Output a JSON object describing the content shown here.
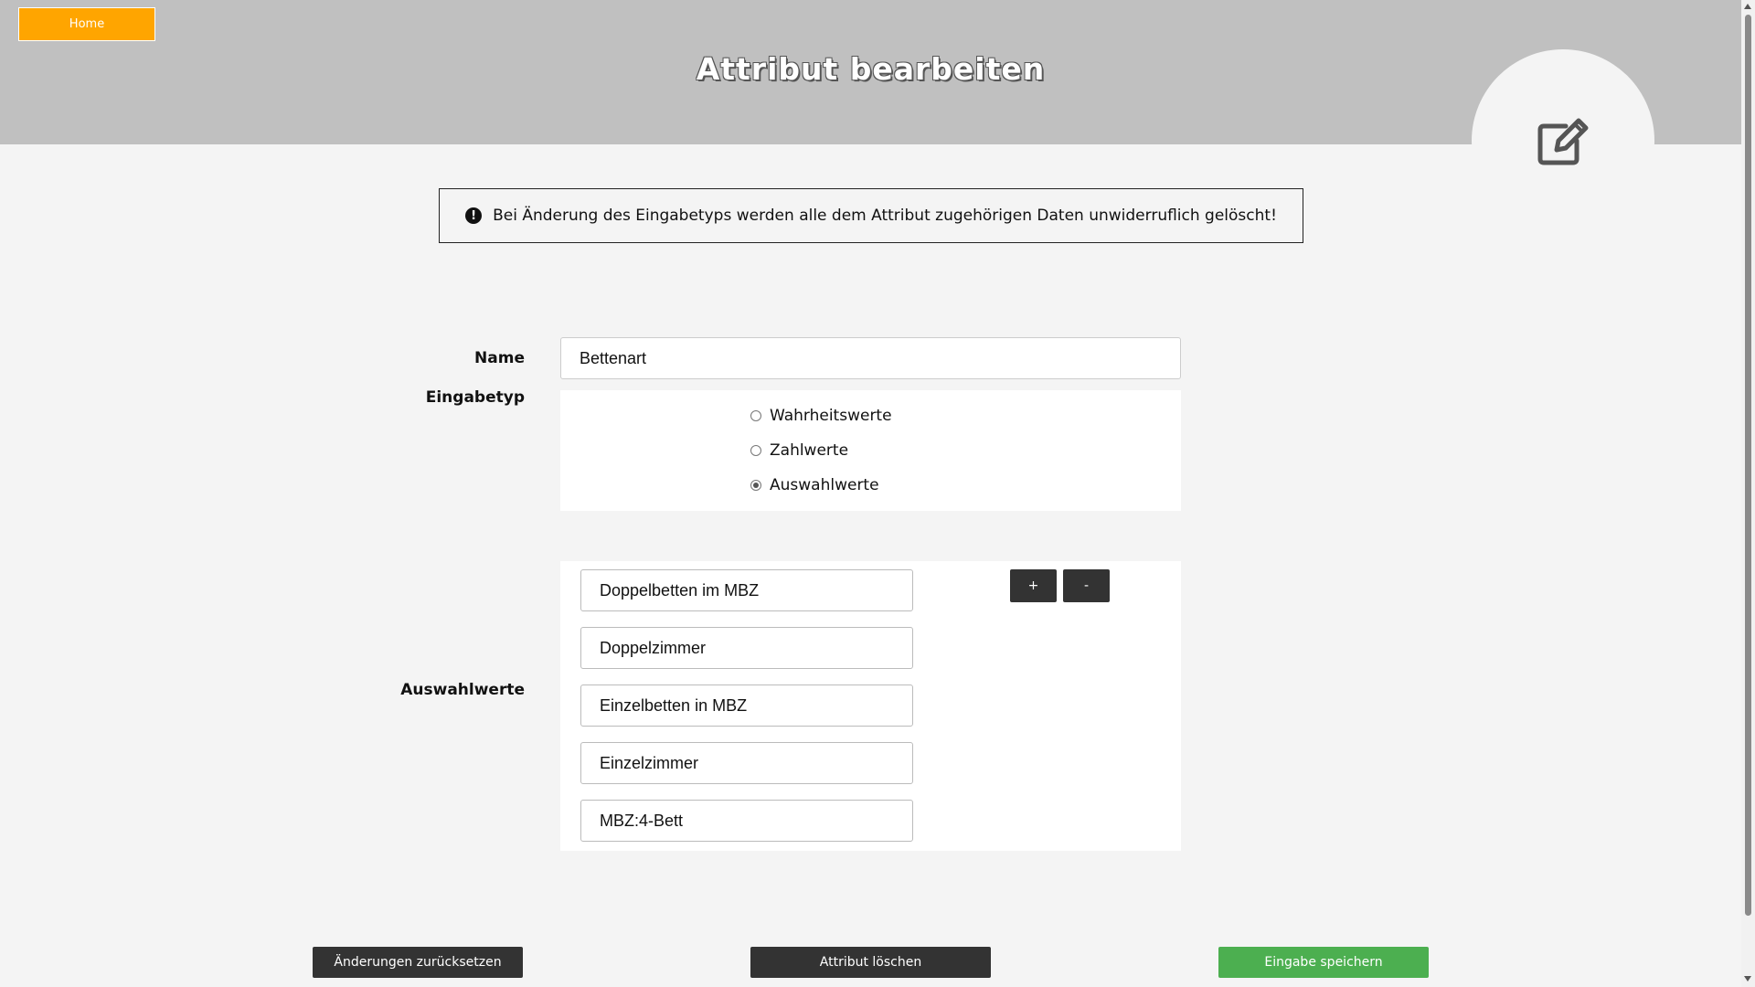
{
  "header": {
    "home_label": "Home",
    "title": "Attribut bearbeiten",
    "bg_color": "#c0c0c0",
    "home_color": "#ffa500",
    "icon": "edit-icon"
  },
  "warning": {
    "icon": "exclamation-circle-icon",
    "text": "Bei Änderung des Eingabetyps werden alle dem Attribut zugehörigen Daten unwiderruflich gelöscht!"
  },
  "form": {
    "name_label": "Name",
    "name_value": "Bettenart",
    "type_label": "Eingabetyp",
    "types": [
      {
        "label": "Wahrheitswerte",
        "checked": false
      },
      {
        "label": "Zahlwerte",
        "checked": false
      },
      {
        "label": "Auswahlwerte",
        "checked": true
      }
    ],
    "options_label": "Auswahlwerte",
    "options": [
      "Doppelbetten im MBZ",
      "Doppelzimmer",
      "Einzelbetten in MBZ",
      "Einzelzimmer",
      "MBZ:4-Bett"
    ],
    "add_label": "+",
    "remove_label": "-"
  },
  "footer": {
    "reset_label": "Änderungen zurücksetzen",
    "delete_label": "Attribut löschen",
    "save_label": "Eingabe speichern",
    "dark_color": "#333333",
    "save_color": "#4caf50"
  }
}
